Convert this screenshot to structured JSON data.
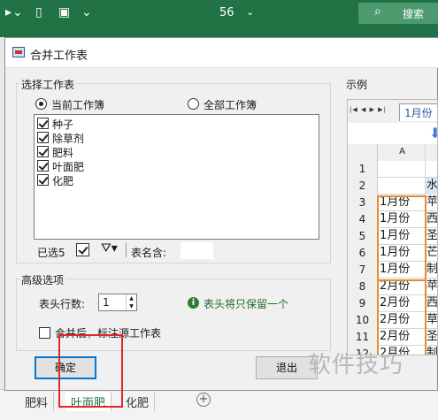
{
  "titlebar": {
    "file_name": "56",
    "search_label": "搜索"
  },
  "dialog": {
    "title": "合并工作表",
    "select_group_label": "选择工作表",
    "radio_current": "当前工作簿",
    "radio_all": "全部工作簿",
    "sheets": [
      {
        "label": "种子",
        "checked": true
      },
      {
        "label": "除草剂",
        "checked": true
      },
      {
        "label": "肥料",
        "checked": true
      },
      {
        "label": "叶面肥",
        "checked": true
      },
      {
        "label": "化肥",
        "checked": true
      }
    ],
    "selected_count": "已选5",
    "name_contains_label": "表名含:",
    "advanced_group_label": "高级选项",
    "header_rows_label": "表头行数:",
    "header_rows_value": "1",
    "header_info": "表头将只保留一个",
    "mark_source_label": "合并后，标注源工作表",
    "ok_label": "确定",
    "cancel_label": "退出"
  },
  "example": {
    "label": "示例",
    "tab_label": "1月份",
    "col_a": "A",
    "rows": [
      {
        "n": "1",
        "a": "",
        "b": ""
      },
      {
        "n": "2",
        "a": "",
        "b": "水"
      },
      {
        "n": "3",
        "a": "1月份",
        "b": "苹"
      },
      {
        "n": "4",
        "a": "1月份",
        "b": "西"
      },
      {
        "n": "5",
        "a": "1月份",
        "b": "圣"
      },
      {
        "n": "6",
        "a": "1月份",
        "b": "芒"
      },
      {
        "n": "7",
        "a": "1月份",
        "b": "制"
      },
      {
        "n": "8",
        "a": "2月份",
        "b": "苹"
      },
      {
        "n": "9",
        "a": "2月份",
        "b": "西"
      },
      {
        "n": "10",
        "a": "2月份",
        "b": "草"
      },
      {
        "n": "11",
        "a": "2月份",
        "b": "圣"
      },
      {
        "n": "12",
        "a": "2月份",
        "b": "制"
      }
    ]
  },
  "sheet_tabs": [
    "肥料",
    "叶面肥",
    "化肥"
  ],
  "watermark": "软件技巧",
  "colors": {
    "excel_green": "#217346",
    "highlight_red": "#e0282a",
    "orange": "#e88a2e",
    "focus_blue": "#0078d7"
  }
}
